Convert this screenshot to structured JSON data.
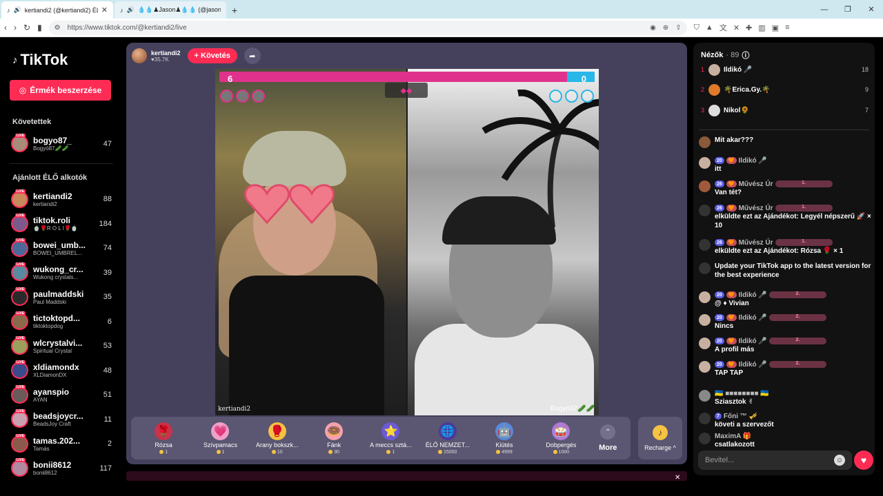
{
  "browser": {
    "tabs": [
      {
        "title": "kertiandi2 (@kertiandi2) ÉLŐ"
      },
      {
        "title": "💧💧♟Jason♟💧💧 (@jason_sam"
      }
    ],
    "url": "https://www.tiktok.com/@kertiandi2/live"
  },
  "sidebar": {
    "logo_text": "TikTok",
    "coins_label": "Érmék beszerzése",
    "followed_heading": "Követettek",
    "followed": [
      {
        "name": "bogyo87_",
        "sub": "Bogyó87🥒🥒",
        "count": "47",
        "color": "#a88c7a"
      }
    ],
    "suggested_heading": "Ajánlott ÉLŐ alkotók",
    "suggested": [
      {
        "name": "kertiandi2",
        "sub": "kertiandi2",
        "count": "88",
        "color": "#c88a5a"
      },
      {
        "name": "tiktok.roli",
        "sub": "🍵🌹R O L I🌹🍵",
        "count": "184",
        "color": "#7a5a8c"
      },
      {
        "name": "bowei_umb...",
        "sub": "BOWEI_UMBREL...",
        "count": "74",
        "color": "#4a6a9a"
      },
      {
        "name": "wukong_cr...",
        "sub": "Wukong crystals...",
        "count": "39",
        "color": "#5a8aa0"
      },
      {
        "name": "paulmaddski",
        "sub": "Paul Maddski",
        "count": "35",
        "color": "#2a2a2a"
      },
      {
        "name": "tictoktopd...",
        "sub": "tiktoktopdog",
        "count": "6",
        "color": "#8a6a4a"
      },
      {
        "name": "wlcrystalvi...",
        "sub": "Spiritual Crystal",
        "count": "53",
        "color": "#9aa05a"
      },
      {
        "name": "xldiamondx",
        "sub": "XLDiamonDX",
        "count": "48",
        "color": "#3a4a8a"
      },
      {
        "name": "ayanspio",
        "sub": "AYAN",
        "count": "51",
        "color": "#6a5a5a"
      },
      {
        "name": "beadsjoycr...",
        "sub": "BeadsJoy Craft",
        "count": "11",
        "color": "#c8a0b0"
      },
      {
        "name": "tamas.202...",
        "sub": "Tamás",
        "count": "2",
        "color": "#8a5a4a"
      },
      {
        "name": "bonii8612",
        "sub": "bonii8612",
        "count": "117",
        "color": "#b08aa0"
      }
    ]
  },
  "stream": {
    "host_name": "kertiandi2",
    "host_likes": "♥35.7K",
    "follow_label": "+ Követés",
    "score_left": "6",
    "score_right": "0",
    "label_left": "kertiandi2",
    "label_right": "Bogyó87🥒🥒",
    "gifts": [
      {
        "name": "Rózsa",
        "price": "1",
        "icon": "🌹"
      },
      {
        "name": "Szívpamacs",
        "price": "1",
        "icon": "💗"
      },
      {
        "name": "Arany bokszk...",
        "price": "10",
        "icon": "🥊"
      },
      {
        "name": "Fánk",
        "price": "30",
        "icon": "🍩"
      },
      {
        "name": "A meccs sztá...",
        "price": "1",
        "icon": "⭐"
      },
      {
        "name": "ÉLŐ NEMZET...",
        "price": "15000",
        "icon": "🌐"
      },
      {
        "name": "Kiütés",
        "price": "4999",
        "icon": "🤖"
      },
      {
        "name": "Dobpergés",
        "price": "1000",
        "icon": "🥁"
      }
    ],
    "more_label": "More",
    "recharge_label": "Recharge ^"
  },
  "chat": {
    "viewers_label": "Nézők",
    "viewers_count": "· 89",
    "ranking": [
      {
        "rank": "1",
        "name": "Ildikó 🎤",
        "score": "18",
        "color": "#c8b0a0"
      },
      {
        "rank": "2",
        "name": "🌴Erica.Gy.🌴",
        "score": "9",
        "color": "#e07a2a"
      },
      {
        "rank": "3",
        "name": "Nikol🌻",
        "score": "7",
        "color": "#ddd"
      }
    ],
    "messages": [
      {
        "name": "",
        "level": "",
        "fan": "",
        "gift": "",
        "text": "Mit akar???",
        "color": "#8a5a3a"
      },
      {
        "name": "Ildikó 🎤",
        "level": "20",
        "fan": "🧡",
        "gift": "",
        "text": "itt",
        "color": "#c8b0a0"
      },
      {
        "name": "Művész Úr",
        "level": "26",
        "fan": "🧡",
        "gift": "1.",
        "text": "Van tét?",
        "color": "#a05a3a"
      },
      {
        "name": "Művész Úr",
        "level": "26",
        "fan": "🧡",
        "gift": "1.",
        "text": "elküldte ezt az Ajándékot: Legyél népszerű 🚀 × 10",
        "color": "#333"
      },
      {
        "name": "Művész Úr",
        "level": "26",
        "fan": "🧡",
        "gift": "1.",
        "text": "elküldte ezt az Ajándékot: Rózsa 🌹 × 1",
        "color": "#333"
      },
      {
        "name": "",
        "level": "",
        "fan": "",
        "gift": "",
        "text": "Update your TikTok app to the latest version for the best experience",
        "color": "#333"
      },
      {
        "name": "Ildikó 🎤",
        "level": "20",
        "fan": "🧡",
        "gift": "2.",
        "text": "@ ♦ Vivian",
        "color": "#c8b0a0"
      },
      {
        "name": "Ildikó 🎤",
        "level": "20",
        "fan": "🧡",
        "gift": "2.",
        "text": "Nincs",
        "color": "#c8b0a0"
      },
      {
        "name": "Ildikó 🎤",
        "level": "20",
        "fan": "🧡",
        "gift": "2.",
        "text": "A profil más",
        "color": "#c8b0a0"
      },
      {
        "name": "Ildikó 🎤",
        "level": "20",
        "fan": "🧡",
        "gift": "2.",
        "text": "TAP TAP",
        "color": "#c8b0a0"
      },
      {
        "name": "🇺🇦 ■■■■■■■■ 🇺🇦",
        "level": "",
        "fan": "",
        "gift": "",
        "text": "Sziasztok ✌",
        "color": "#888"
      },
      {
        "name": "Főni ™ 🎺",
        "level": "7",
        "fan": "",
        "gift": "",
        "text": "követi a szervezőt",
        "color": "#333"
      },
      {
        "name": "MaximA 🎁",
        "level": "",
        "fan": "",
        "gift": "",
        "text": "csatlakozott",
        "color": "#333"
      }
    ],
    "input_placeholder": "Bevitel..."
  }
}
